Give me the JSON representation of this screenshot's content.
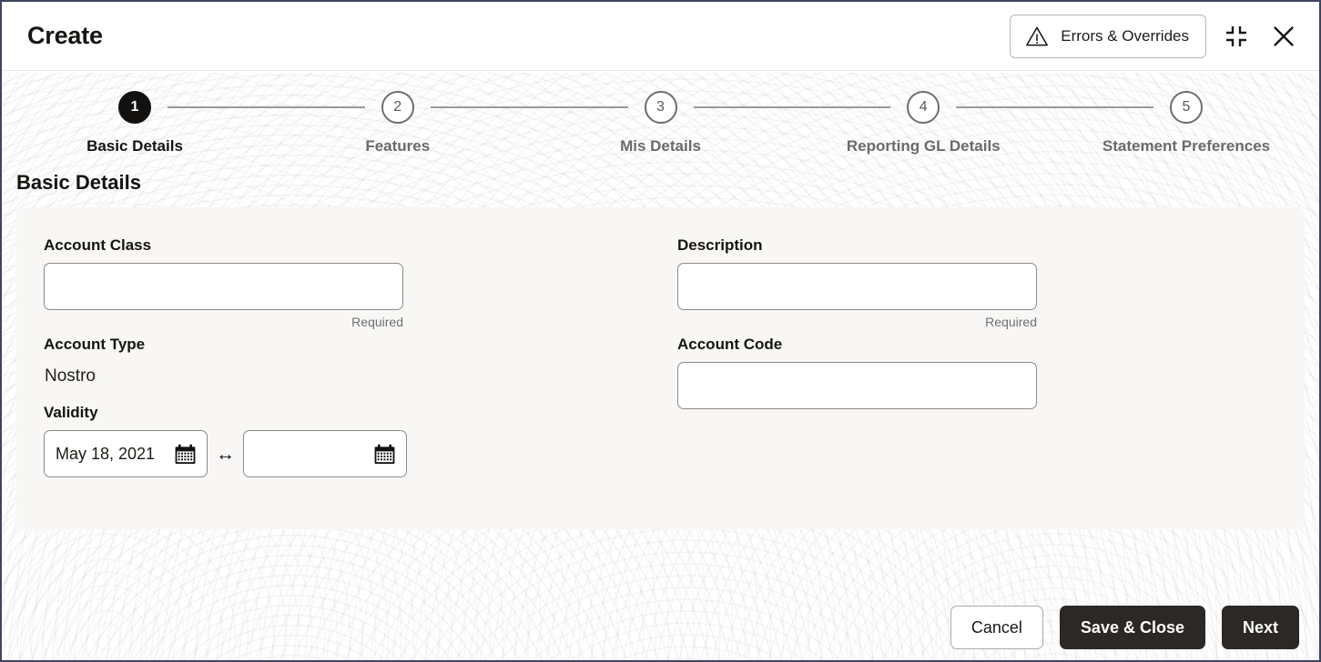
{
  "window": {
    "title": "Create",
    "header": {
      "errors_button_label": "Errors & Overrides",
      "warning_icon": "warning-triangle-icon",
      "minimize_icon": "collapse-corners-icon",
      "close_icon": "close-x-icon"
    }
  },
  "stepper": {
    "steps": [
      {
        "number": "1",
        "label": "Basic Details",
        "active": true
      },
      {
        "number": "2",
        "label": "Features",
        "active": false
      },
      {
        "number": "3",
        "label": "Mis Details",
        "active": false
      },
      {
        "number": "4",
        "label": "Reporting GL Details",
        "active": false
      },
      {
        "number": "5",
        "label": "Statement Preferences",
        "active": false
      }
    ]
  },
  "section": {
    "heading": "Basic Details"
  },
  "form": {
    "account_class": {
      "label": "Account Class",
      "value": "",
      "placeholder": "",
      "helper": "Required"
    },
    "description": {
      "label": "Description",
      "value": "",
      "placeholder": "",
      "helper": "Required"
    },
    "account_type": {
      "label": "Account Type",
      "value": "Nostro"
    },
    "account_code": {
      "label": "Account Code",
      "value": "",
      "placeholder": ""
    },
    "validity": {
      "label": "Validity",
      "start_date": "May 18, 2021",
      "end_date": "",
      "separator": "↔",
      "calendar_icon": "calendar-icon"
    }
  },
  "footer": {
    "cancel_label": "Cancel",
    "save_close_label": "Save & Close",
    "next_label": "Next"
  },
  "colors": {
    "accent_dark": "#2c2825",
    "step_active": "#13110f",
    "step_inactive": "#6d6d6d",
    "card_bg": "#f8f7f5",
    "window_border": "#3f4460",
    "helper_text": "#6f6f6f"
  }
}
